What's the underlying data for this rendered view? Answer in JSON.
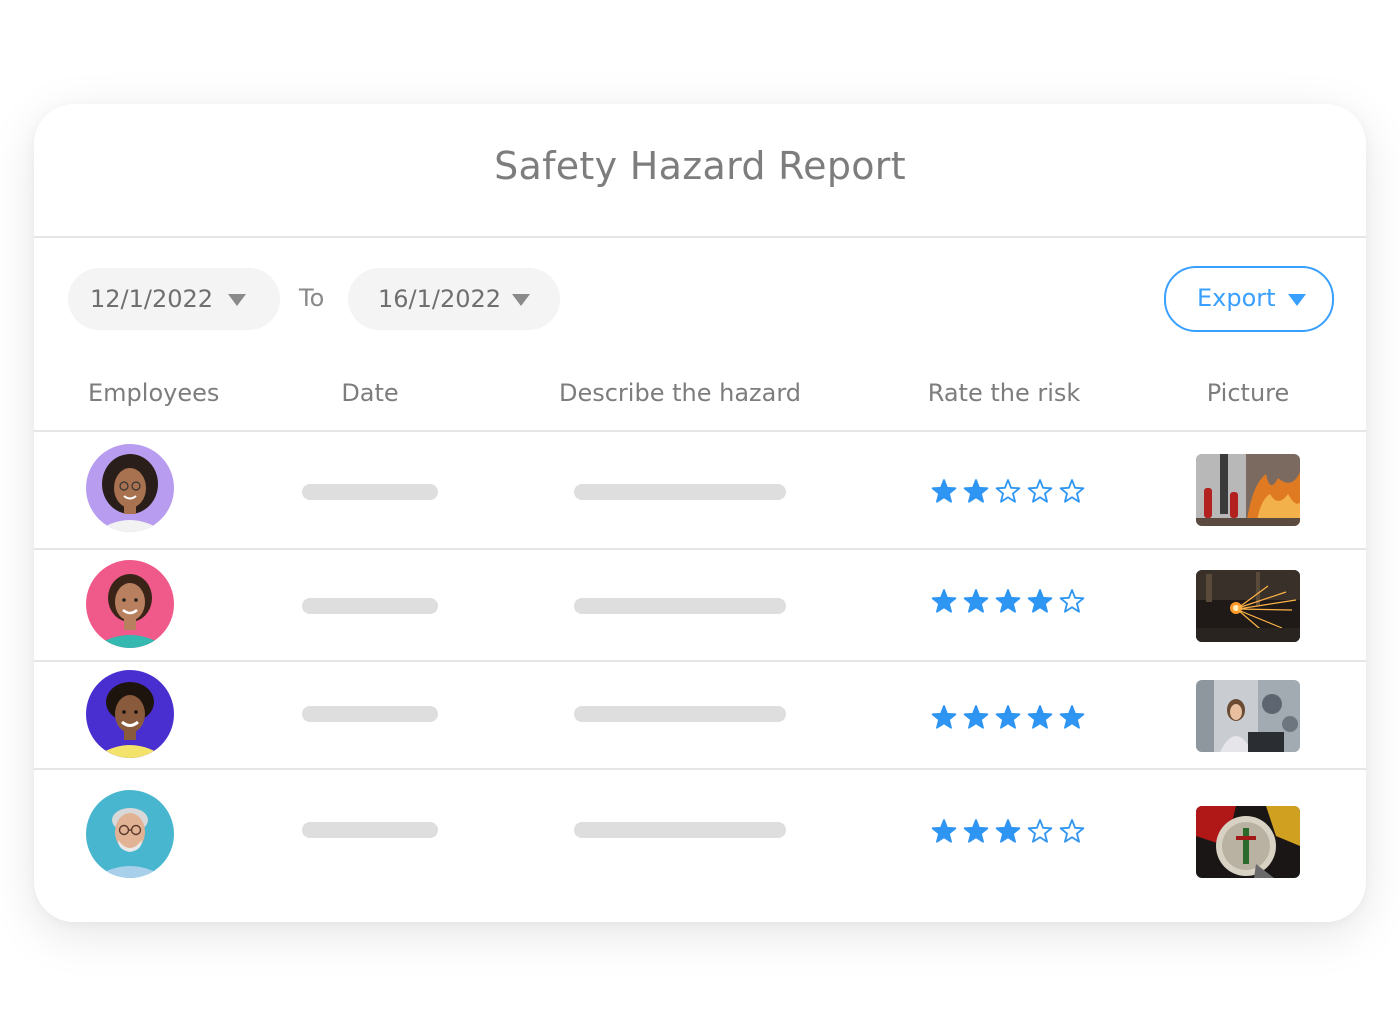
{
  "report": {
    "title": "Safety Hazard Report"
  },
  "filters": {
    "from_date": "12/1/2022",
    "to_label": "To",
    "to_date": "16/1/2022",
    "export_label": "Export"
  },
  "table": {
    "columns": [
      "Employees",
      "Date",
      "Describe the hazard",
      "Rate the risk",
      "Picture"
    ],
    "rows": [
      {
        "risk_rating": 2,
        "max_rating": 5
      },
      {
        "risk_rating": 4,
        "max_rating": 5
      },
      {
        "risk_rating": 5,
        "max_rating": 5
      },
      {
        "risk_rating": 3,
        "max_rating": 5
      }
    ]
  },
  "colors": {
    "accent": "#3aa0ff",
    "star": "#2f95f3",
    "placeholder": "#dedede"
  }
}
